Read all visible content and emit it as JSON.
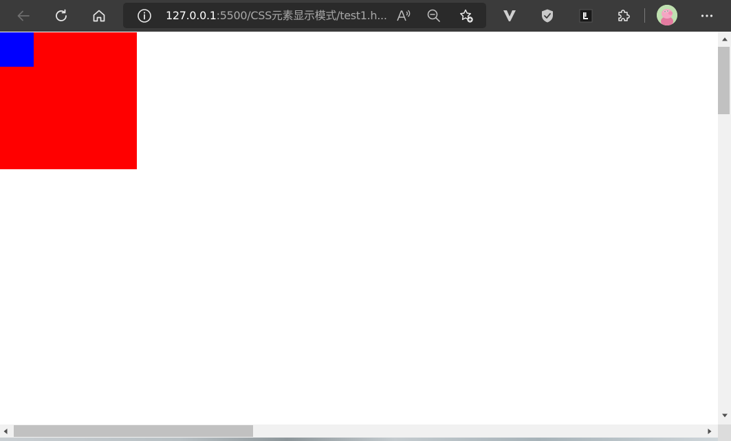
{
  "browser": {
    "address_bar": {
      "url_host": "127.0.0.1",
      "url_rest": ":5500/CSS元素显示模式/test1.h..."
    },
    "icons": {
      "back": "back-arrow-icon",
      "refresh": "refresh-icon",
      "home": "home-icon",
      "site_info": "info-icon",
      "read_aloud": "read-aloud-icon",
      "zoom": "zoom-out-icon",
      "favorite": "add-favorite-icon",
      "extension_v": "v-extension-icon",
      "extension_shield": "shield-extension-icon",
      "extension_l": "l-extension-icon",
      "extensions": "puzzle-icon",
      "profile": "avatar",
      "menu": "more-menu-icon"
    }
  },
  "page": {
    "outer_box_color": "#ff0000",
    "inner_box_color": "#0000ff",
    "background_color": "#ffffff"
  },
  "colors": {
    "toolbar": "#3b3b3b",
    "address_bar": "#2a2a2a",
    "scrollbar_track": "#f1f1f1",
    "scrollbar_thumb": "#c1c1c1"
  }
}
